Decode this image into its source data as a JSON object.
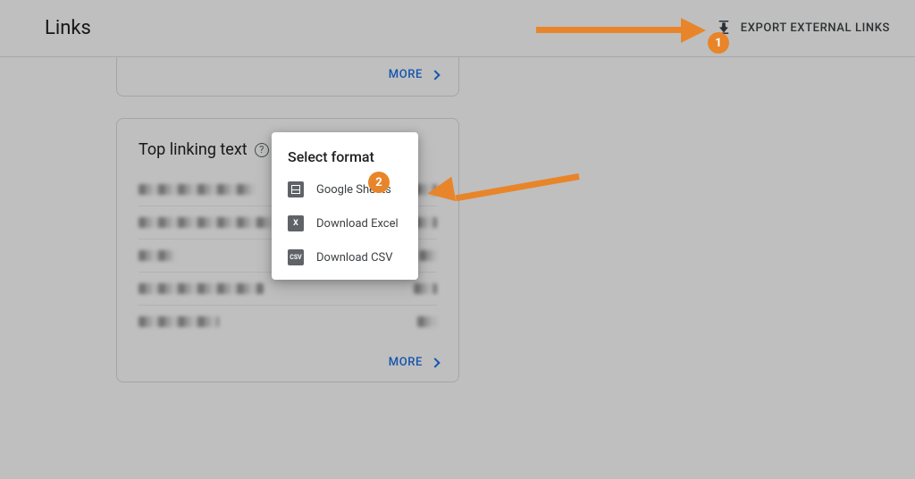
{
  "header": {
    "title": "Links",
    "export_label": "EXPORT EXTERNAL LINKS"
  },
  "card_top": {
    "more_label": "MORE"
  },
  "card_linking_text": {
    "title": "Top linking text",
    "more_label": "MORE"
  },
  "popup": {
    "title": "Select format",
    "items": [
      {
        "icon": "sheets",
        "label": "Google Sheets"
      },
      {
        "icon": "X",
        "label": "Download Excel"
      },
      {
        "icon": "CSV",
        "label": "Download CSV"
      }
    ]
  },
  "annotations": {
    "badge1": "1",
    "badge2": "2"
  }
}
